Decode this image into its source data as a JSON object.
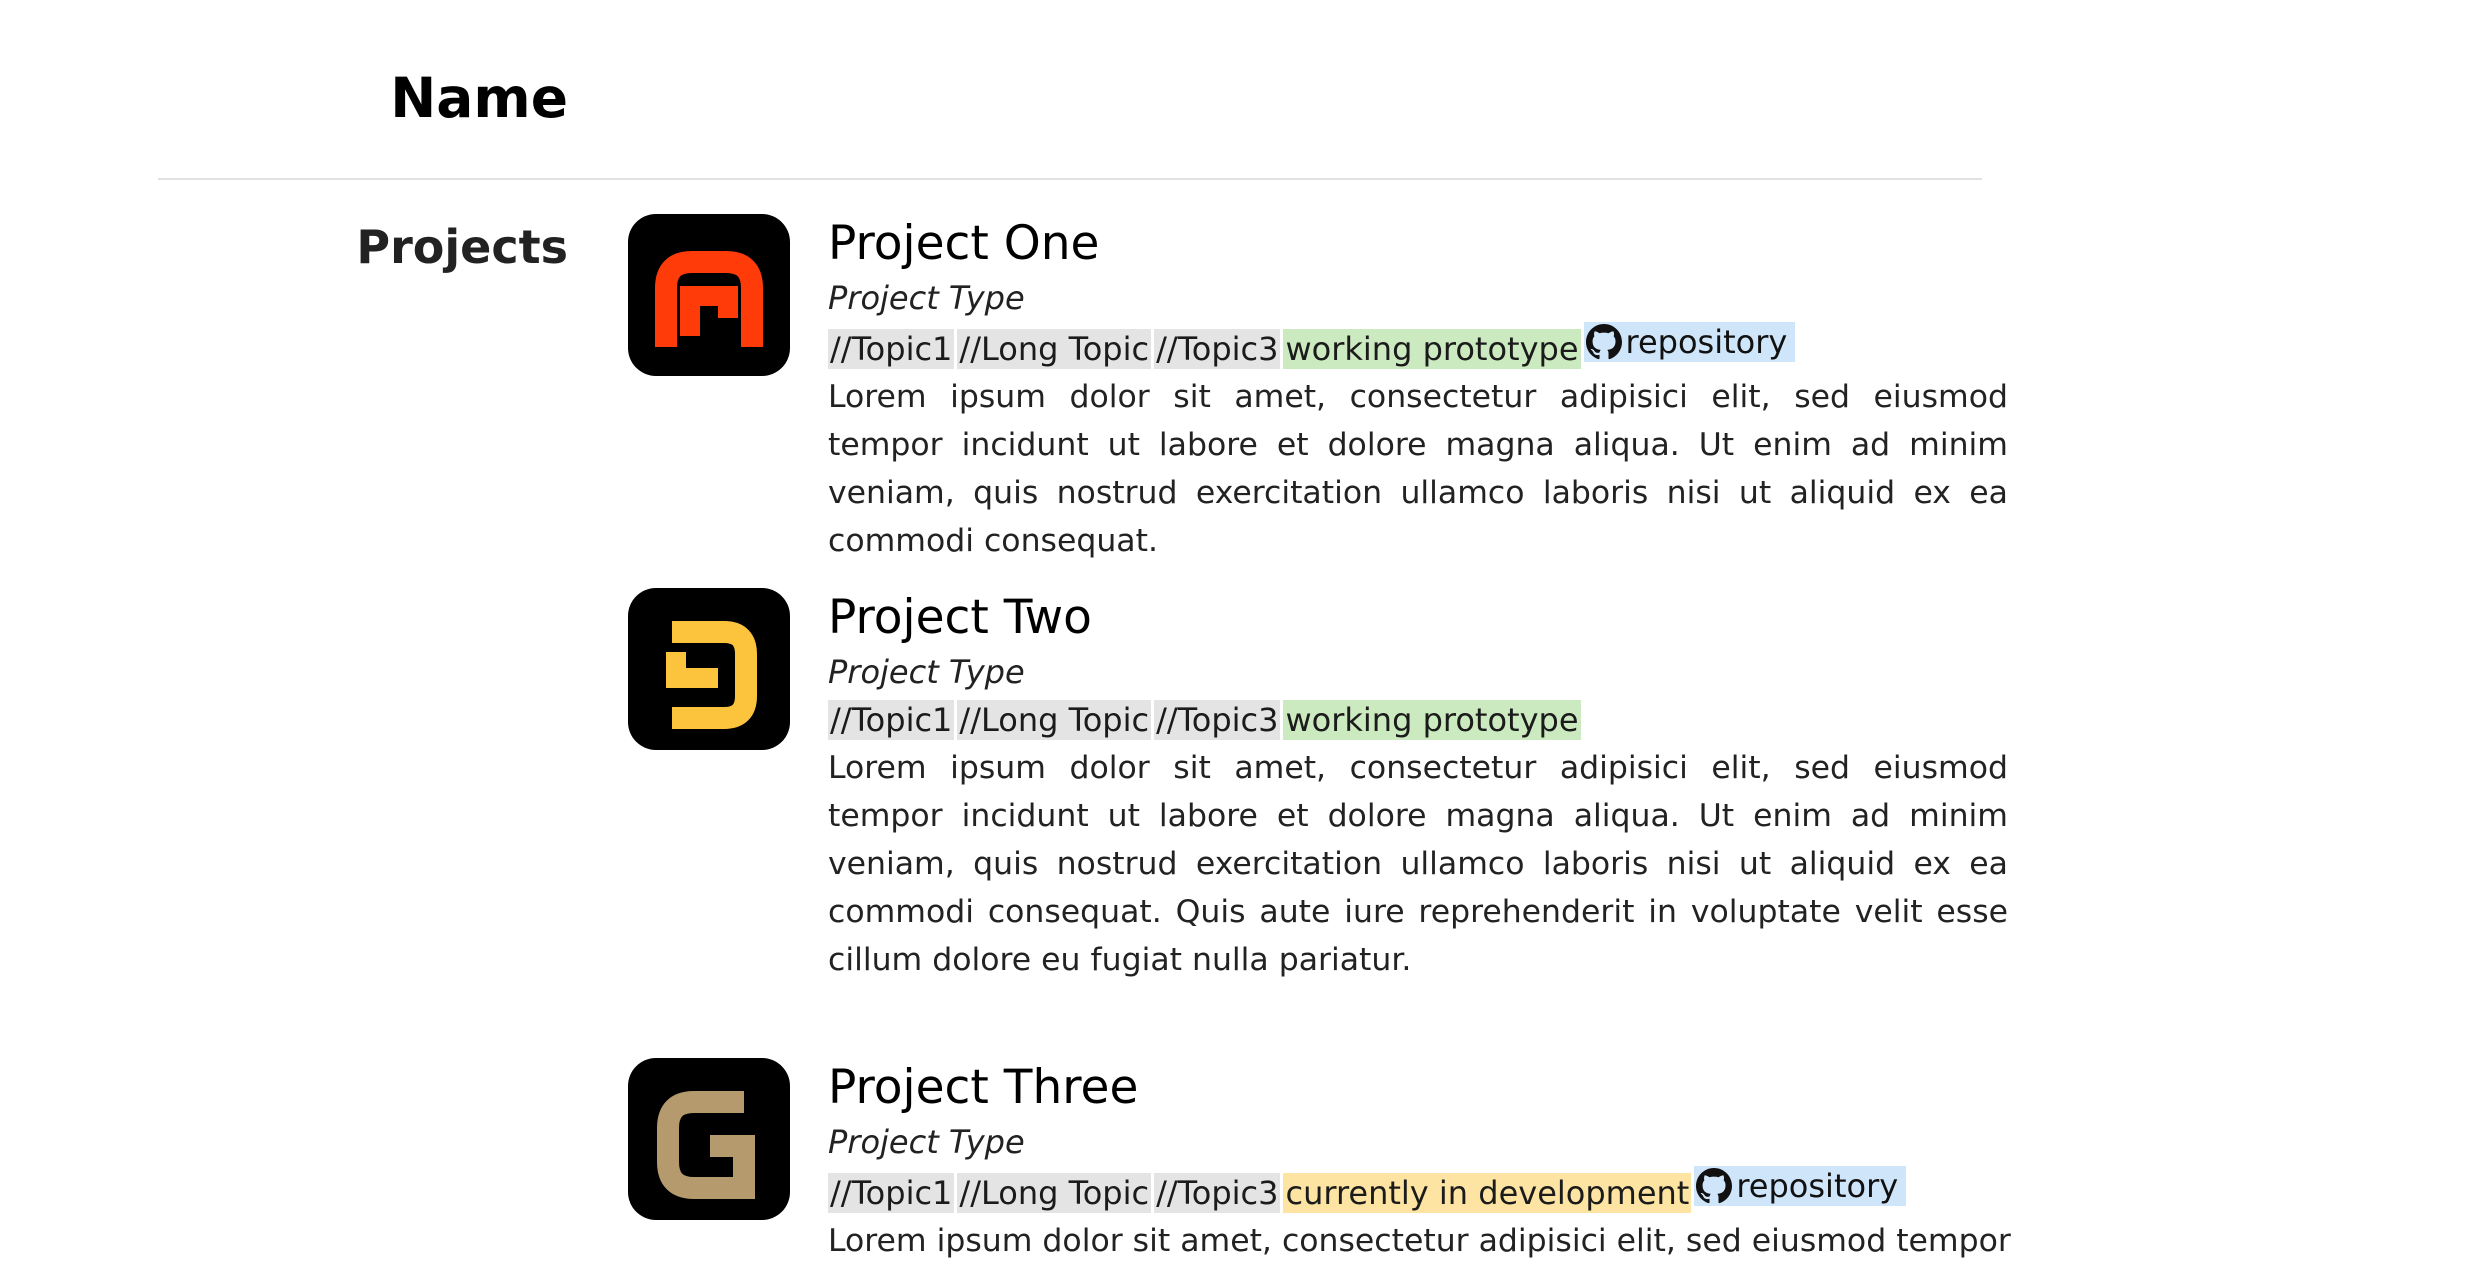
{
  "header": {
    "name": "Name"
  },
  "section": {
    "label": "Projects"
  },
  "projects": [
    {
      "title": "Project One",
      "type": "Project Type",
      "topics": [
        "//Topic1",
        "//Long Topic",
        "//Topic3"
      ],
      "status": "working prototype",
      "repo": "repository",
      "description": "Lorem ipsum dolor sit amet, consectetur adipisici elit, sed eiusmod tempor incidunt ut labore et dolore magna aliqua. Ut enim ad minim veniam, quis nostrud exercitation ullamco laboris nisi ut aliquid ex ea commodi consequat.",
      "logo_color": "#ff3b0a"
    },
    {
      "title": "Project Two",
      "type": "Project Type",
      "topics": [
        "//Topic1",
        "//Long Topic",
        "//Topic3"
      ],
      "status": "working prototype",
      "description": "Lorem ipsum dolor sit amet, consectetur adipisici elit, sed eiusmod tempor incidunt ut labore et dolore magna aliqua. Ut enim ad minim veniam, quis nostrud exercitation ullamco laboris nisi ut aliquid ex ea commodi consequat. Quis aute iure reprehenderit in voluptate velit esse cillum dolore eu fugiat nulla pariatur.",
      "logo_color": "#fcc43c"
    },
    {
      "title": "Project Three",
      "type": "Project Type",
      "topics": [
        "//Topic1",
        "//Long Topic",
        "//Topic3"
      ],
      "status": "currently in development",
      "repo": "repository",
      "description": "Lorem ipsum dolor sit amet, consectetur adipisici elit, sed eiusmod tempor",
      "logo_color": "#b49a6c"
    }
  ],
  "icons": {
    "repo": "github-icon"
  }
}
